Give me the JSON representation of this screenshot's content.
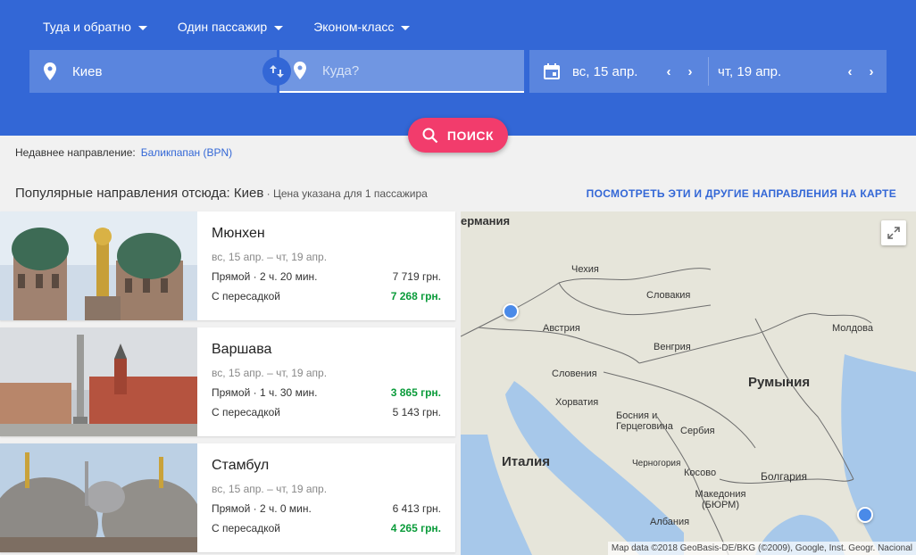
{
  "header": {
    "trip_type": "Туда и обратно",
    "passengers": "Один пассажир",
    "cabin": "Эконом-класс",
    "from_value": "Киев",
    "to_placeholder": "Куда?",
    "depart_date": "вс, 15 апр.",
    "return_date": "чт, 19 апр.",
    "search_label": "ПОИСК",
    "colors": {
      "header_bg": "#3367d6",
      "search_btn": "#f23c6c"
    }
  },
  "recent": {
    "label": "Недавнее направление:",
    "link": "Баликпапан (BPN)"
  },
  "popular": {
    "title": "Популярные направления отсюда: Киев",
    "subtitle": " · Цена указана для 1 пассажира",
    "map_link": "ПОСМОТРЕТЬ ЭТИ И ДРУГИЕ НАПРАВЛЕНИЯ НА КАРТЕ"
  },
  "destinations": [
    {
      "city": "Мюнхен",
      "dates": "вс, 15 апр. – чт, 19 апр.",
      "direct_label": "Прямой · 2 ч. 20 мин.",
      "direct_price": "7 719 грн.",
      "transfer_label": "С пересадкой",
      "transfer_price": "7 268 грн."
    },
    {
      "city": "Варшава",
      "dates": "вс, 15 апр. – чт, 19 апр.",
      "direct_label": "Прямой · 1 ч. 30 мин.",
      "direct_price": "3 865 грн.",
      "transfer_label": "С пересадкой",
      "transfer_price": "5 143 грн."
    },
    {
      "city": "Стамбул",
      "dates": "вс, 15 апр. – чт, 19 апр.",
      "direct_label": "Прямой · 2 ч. 0 мин.",
      "direct_price": "6 413 грн.",
      "transfer_label": "С пересадкой",
      "transfer_price": "4 265 грн."
    }
  ],
  "map": {
    "labels": {
      "germany": "ермания",
      "czech": "Чехия",
      "slovakia": "Словакия",
      "austria": "Австрия",
      "hungary": "Венгрия",
      "moldova": "Молдова",
      "romania": "Румыния",
      "slovenia": "Словения",
      "croatia": "Хорватия",
      "bosnia": "Босния и Герцеговина",
      "serbia": "Сербия",
      "italy": "Италия",
      "montenegro": "Черногория",
      "kosovo": "Косово",
      "bulgaria": "Болгария",
      "macedonia": "Македония (БЮРМ)",
      "albania": "Албания"
    },
    "attribution": "Map data ©2018 GeoBasis-DE/BKG (©2009), Google, Inst. Geogr. Nacional"
  }
}
